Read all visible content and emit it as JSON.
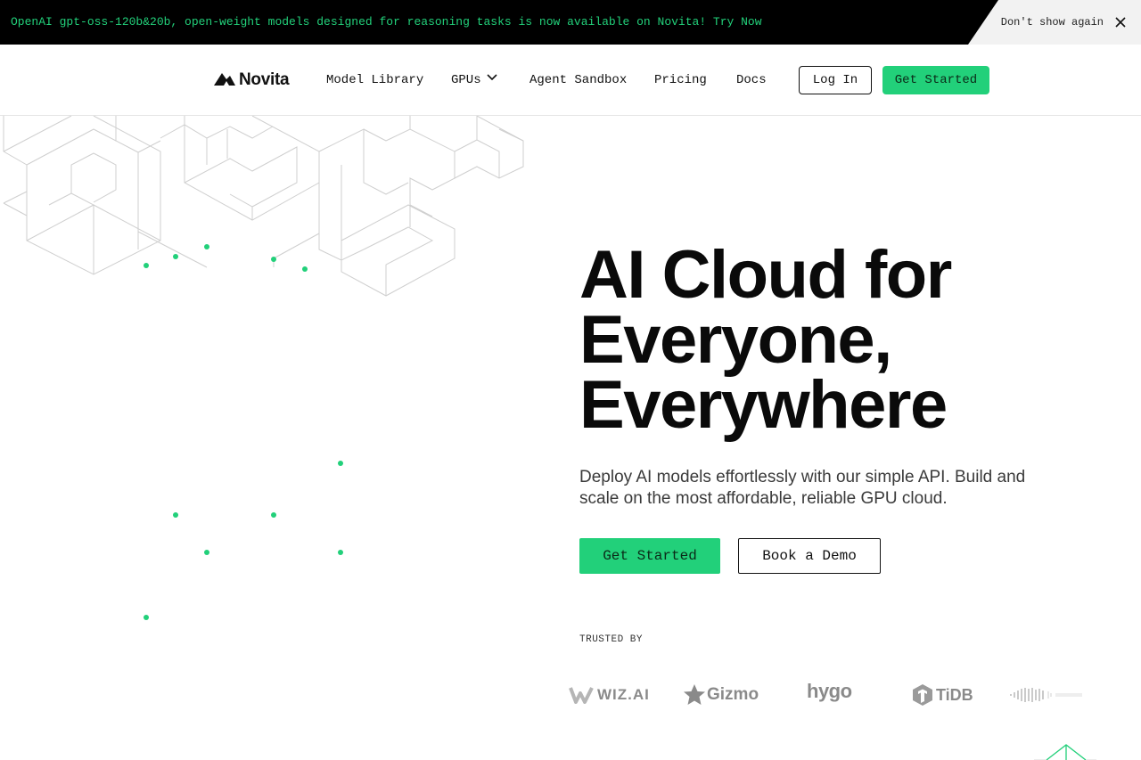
{
  "announcement": {
    "text": "OpenAI gpt-oss-120b&20b, open-weight models designed for reasoning tasks is now available on Novita! Try Now",
    "dismiss_label": "Don't show again",
    "close_icon": "close-icon"
  },
  "nav": {
    "brand": "Novita",
    "links": {
      "model_library": "Model Library",
      "gpus": "GPUs",
      "agent_sandbox": "Agent Sandbox",
      "pricing": "Pricing",
      "docs": "Docs"
    },
    "login_label": "Log In",
    "get_started_label": "Get Started"
  },
  "hero": {
    "title_lines": [
      "AI Cloud for",
      "Everyone,",
      "Everywhere"
    ],
    "subtitle": "Deploy AI models effortlessly with our simple API. Build and scale on the most affordable, reliable GPU cloud.",
    "primary_cta": "Get Started",
    "secondary_cta": "Book a Demo"
  },
  "trusted": {
    "label": "TRUSTED BY",
    "logos": [
      "WIZ.AI",
      "Gizmo",
      "hygo",
      "TiDB"
    ]
  },
  "colors": {
    "accent": "#22d07a",
    "announcement_bg": "#000000",
    "text": "#0a0a0a",
    "logo_gray": "#8a8a8a"
  }
}
